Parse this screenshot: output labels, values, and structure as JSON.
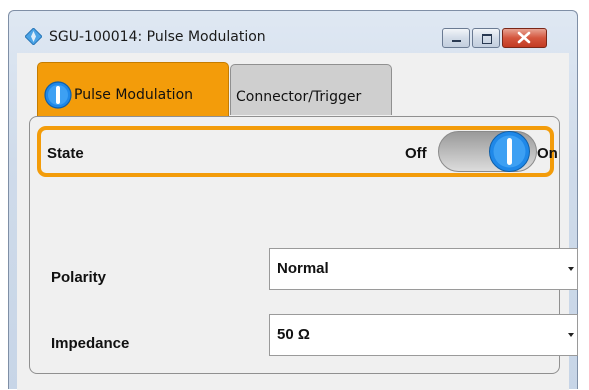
{
  "window": {
    "title": "SGU-100014: Pulse Modulation",
    "icon": "diamond-arrows-icon",
    "controls": [
      "minimize-icon",
      "maximize-icon",
      "close-icon"
    ]
  },
  "tabs": [
    {
      "label": "Pulse Modulation",
      "active": true,
      "icon": "toggle-on-icon"
    },
    {
      "label": "Connector/Trigger",
      "active": false
    }
  ],
  "state": {
    "label": "State",
    "off_label": "Off",
    "on_label": "On",
    "value": "On"
  },
  "polarity": {
    "label": "Polarity",
    "value": "Normal"
  },
  "impedance": {
    "label": "Impedance",
    "value": "50 Ω"
  },
  "colors": {
    "accent": "#f39c0a",
    "toggle_knob": "#1f88e8",
    "close_button": "#d4563e"
  }
}
